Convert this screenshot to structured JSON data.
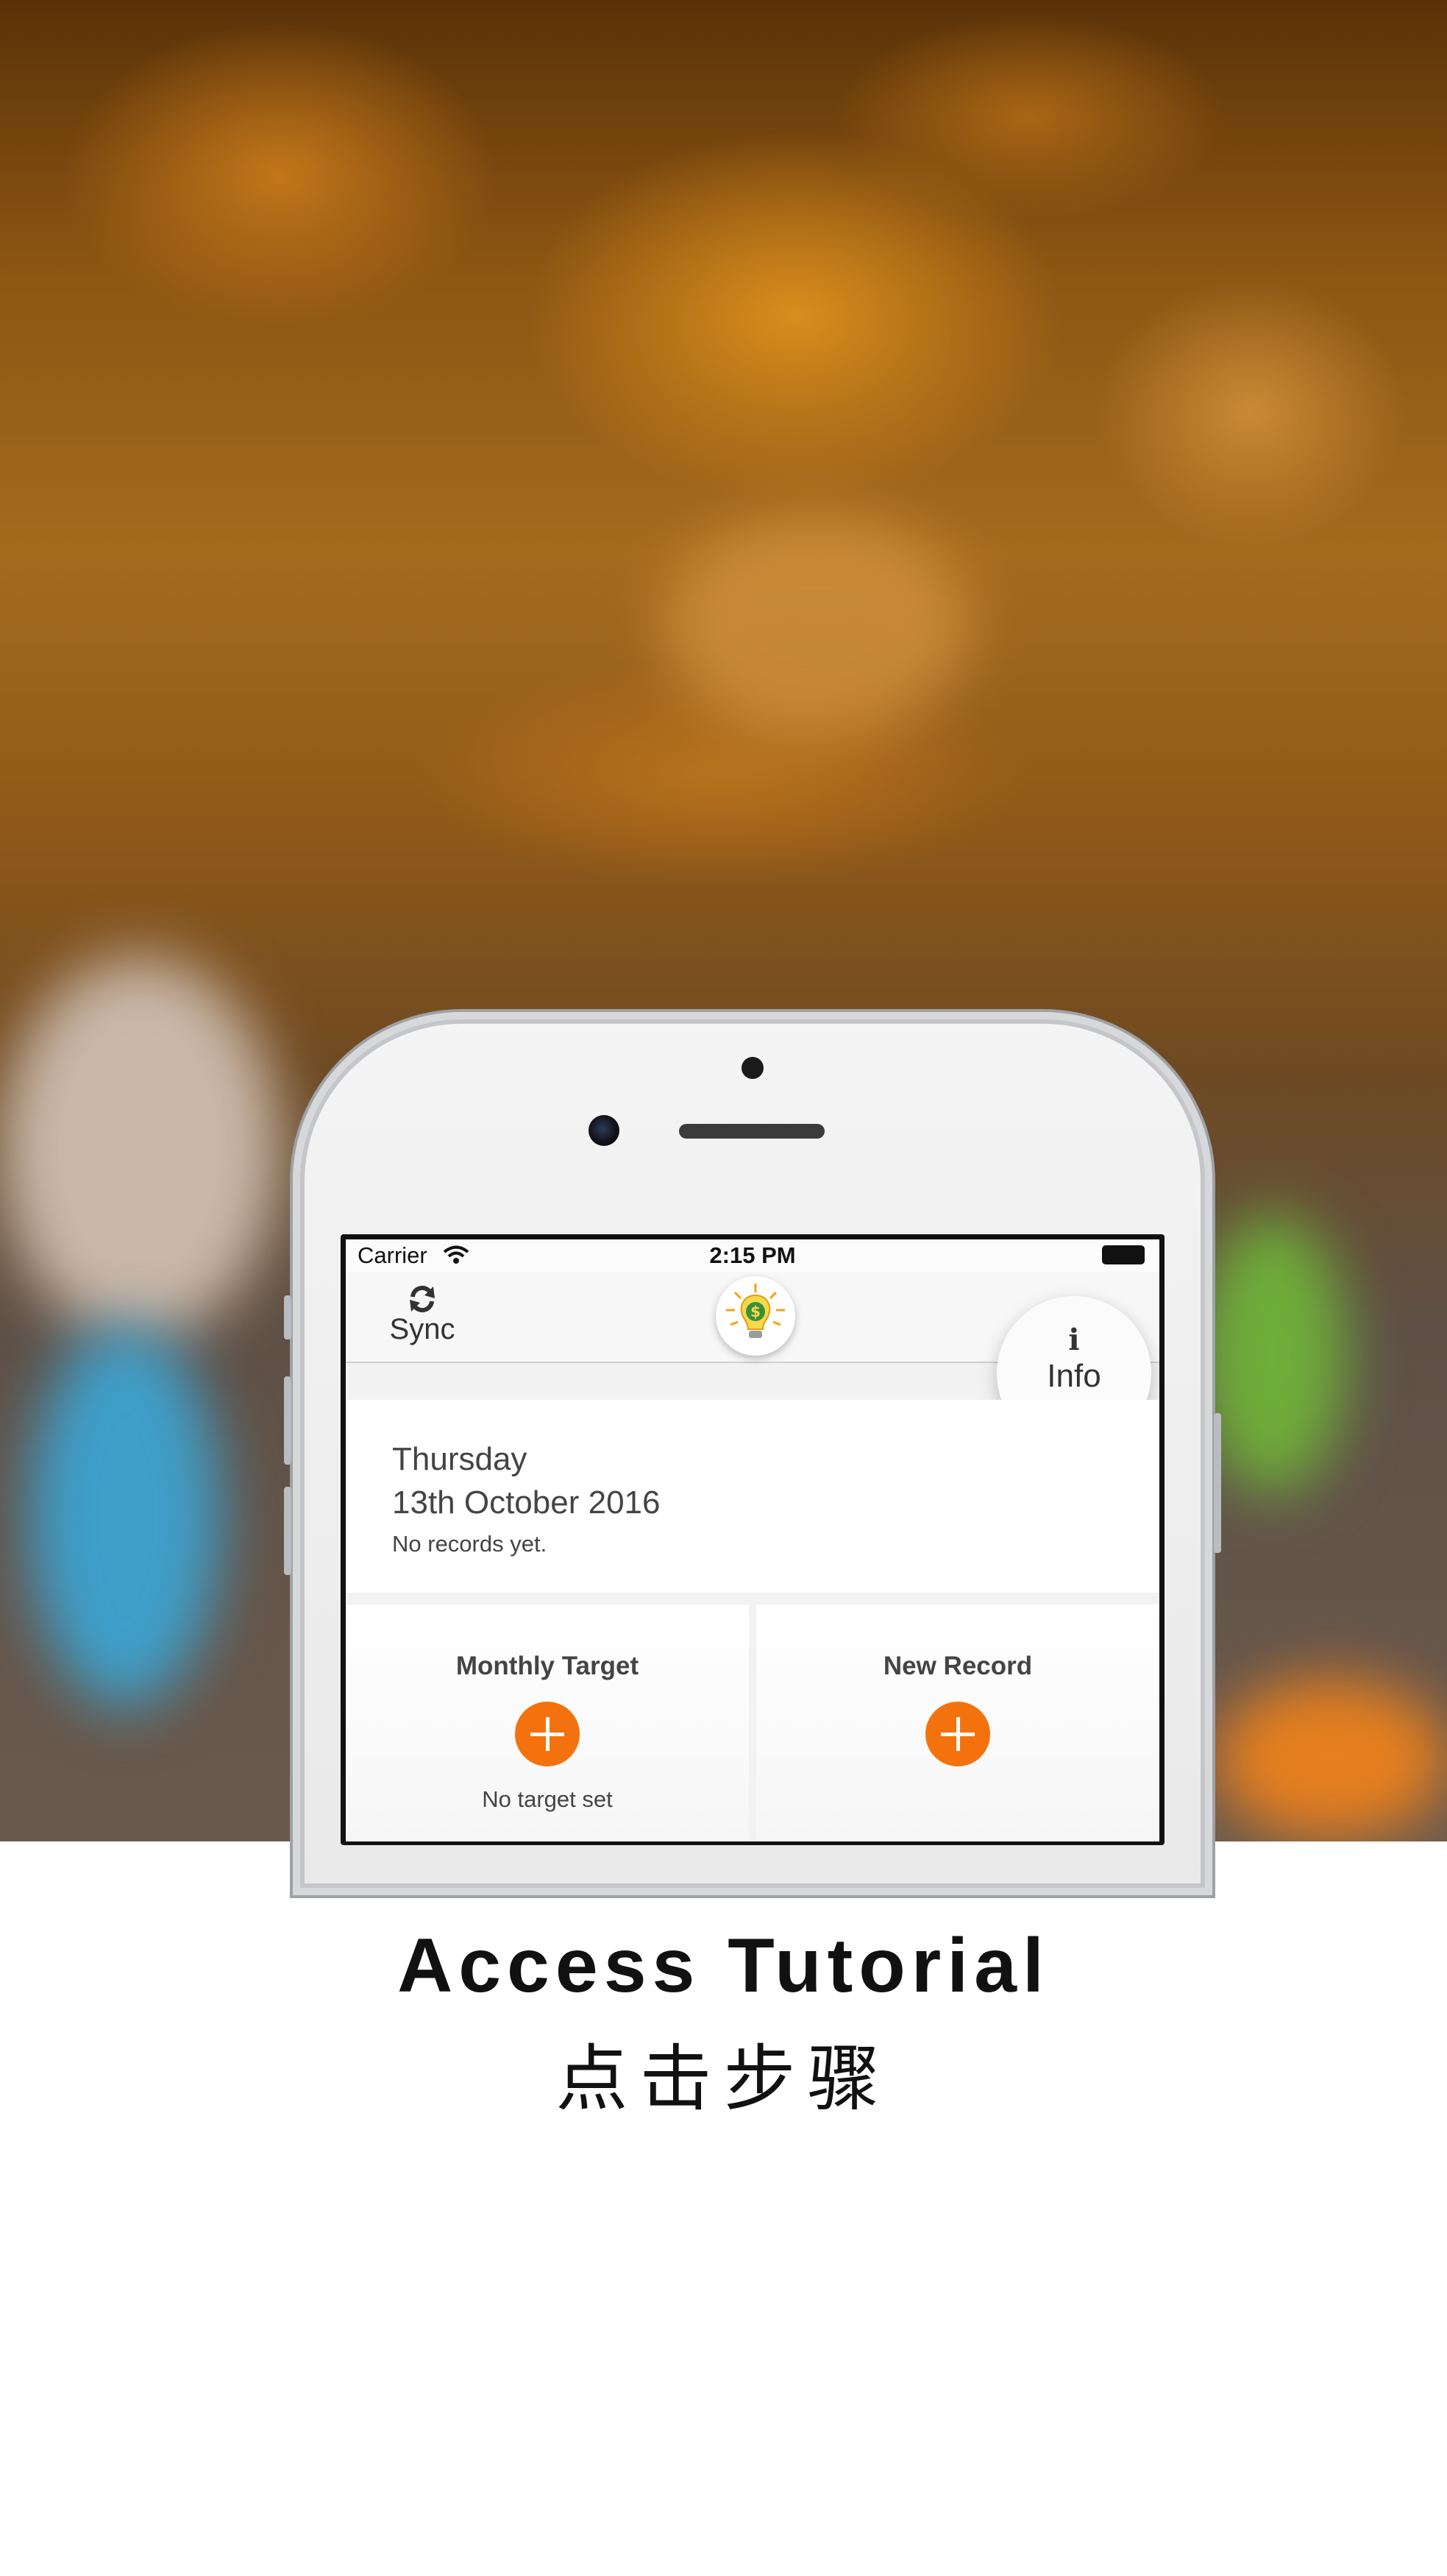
{
  "status_bar": {
    "carrier": "Carrier",
    "time": "2:15 PM"
  },
  "nav": {
    "sync_label": "Sync",
    "info_label": "Info",
    "logo_icon": "lightbulb-dollar-icon"
  },
  "date_card": {
    "weekday": "Thursday",
    "date": "13th October 2016",
    "status": "No records yet."
  },
  "tiles": [
    {
      "title": "Monthly Target",
      "note": "No target set"
    },
    {
      "title": "New Record",
      "note": ""
    }
  ],
  "caption": {
    "title": "Access Tutorial",
    "subtitle": "点击步骤"
  },
  "colors": {
    "accent": "#f4720d",
    "text": "#444444"
  }
}
